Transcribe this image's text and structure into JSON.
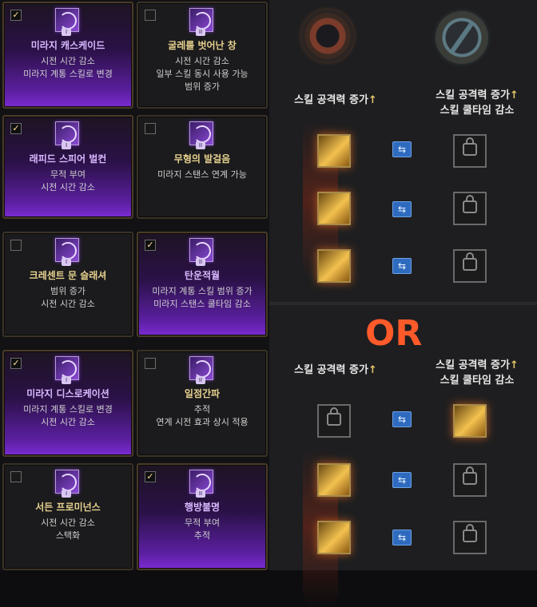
{
  "colors": {
    "accent_orange": "#ff5a2a",
    "title_gold": "#e8d28f",
    "title_purple": "#d9b8ff",
    "swap_blue": "#2e6bbf"
  },
  "cards": [
    {
      "id": "c1",
      "checked": true,
      "tier": "I",
      "title": "미라지 캐스케이드",
      "lines": [
        "시전 시간 감소",
        "미라지 계통 스킬로 변경"
      ]
    },
    {
      "id": "c2",
      "checked": false,
      "tier": "II",
      "title": "굴레를 벗어난 창",
      "lines": [
        "시전 시간 감소",
        "일부 스킬 동시 사용 가능",
        "범위 증가"
      ]
    },
    {
      "id": "c3",
      "checked": true,
      "tier": "I",
      "title": "래피드 스피어 벌컨",
      "lines": [
        "무적 부여",
        "시전 시간 감소"
      ]
    },
    {
      "id": "c4",
      "checked": false,
      "tier": "II",
      "title": "무형의 발걸음",
      "lines": [
        "미라지 스탠스 연계 가능"
      ]
    },
    {
      "id": "c5",
      "checked": false,
      "tier": "I",
      "title": "크레센트 문 슬래셔",
      "lines": [
        "범위 증가",
        "시전 시간 감소"
      ]
    },
    {
      "id": "c6",
      "checked": true,
      "tier": "II",
      "title": "탄운적월",
      "lines": [
        "미라지 계통 스킬 범위 증가",
        "미라지 스탠스 쿨타임 감소"
      ]
    },
    {
      "id": "c7",
      "checked": true,
      "tier": "I",
      "title": "미라지 디스로케이션",
      "lines": [
        "미라지 계통 스킬로 변경",
        "시전 시간 감소"
      ]
    },
    {
      "id": "c8",
      "checked": false,
      "tier": "II",
      "title": "일점간파",
      "lines": [
        "추적",
        "연계 시전 효과 상시 적용"
      ]
    },
    {
      "id": "c9",
      "checked": false,
      "tier": "I",
      "title": "서든 프로미넌스",
      "lines": [
        "시전 시간 감소",
        "스택화"
      ]
    },
    {
      "id": "c10",
      "checked": true,
      "tier": "II",
      "title": "행방불명",
      "lines": [
        "무적 부여",
        "추적"
      ]
    }
  ],
  "right": {
    "top": {
      "left_label": "스킬 공격력 증가",
      "right_label_1": "스킬 공격력 증가",
      "right_label_2": "스킬 쿨타임 감소"
    },
    "or_text": "OR",
    "bottom": {
      "left_label": "스킬 공격력 증가",
      "right_label_1": "스킬 공격력 증가",
      "right_label_2": "스킬 쿨타임 감소"
    },
    "arrow": "↑",
    "swap_glyph": "⇆"
  }
}
